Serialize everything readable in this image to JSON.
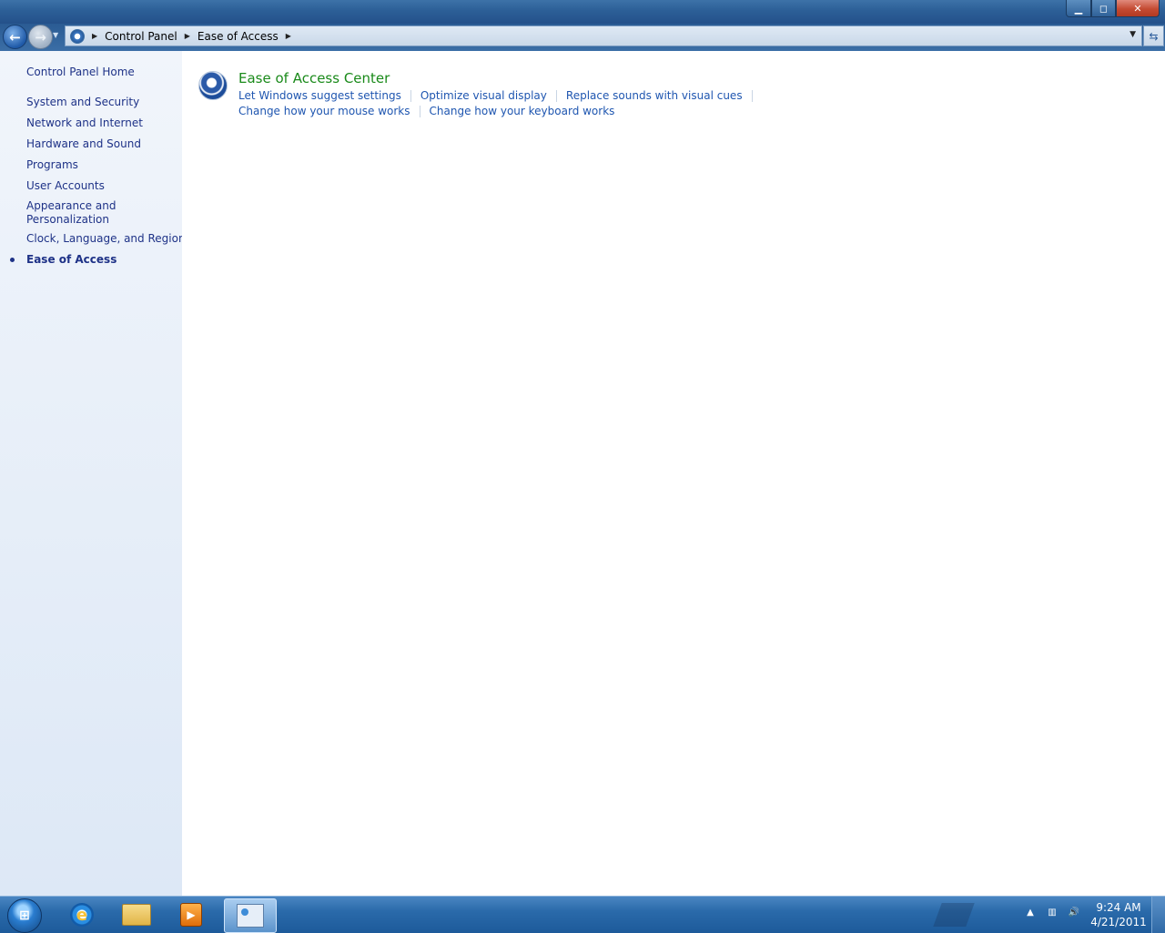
{
  "window": {
    "controls": {
      "minimize": "▁",
      "maximize": "◻",
      "close": "✕"
    }
  },
  "nav": {
    "back_icon": "arrow-left",
    "forward_icon": "arrow-right",
    "breadcrumbs": [
      "Control Panel",
      "Ease of Access"
    ],
    "refresh_icon": "refresh"
  },
  "sidebar": {
    "home": "Control Panel Home",
    "items": [
      "System and Security",
      "Network and Internet",
      "Hardware and Sound",
      "Programs",
      "User Accounts",
      "Appearance and Personalization",
      "Clock, Language, and Region",
      "Ease of Access"
    ],
    "current_item": "Ease of Access"
  },
  "main": {
    "category": {
      "title": "Ease of Access Center",
      "icon": "ease-of-access-icon",
      "title_color": "#1a8a1a",
      "links_row1": [
        "Let Windows suggest settings",
        "Optimize visual display",
        "Replace sounds with visual cues"
      ],
      "links_row2": [
        "Change how your mouse works",
        "Change how your keyboard works"
      ]
    }
  },
  "taskbar": {
    "pinned": [
      "internet-explorer-icon",
      "windows-explorer-icon",
      "media-player-icon",
      "control-panel-icon"
    ],
    "active": "control-panel-icon",
    "clock": {
      "time": "9:24 AM",
      "date": "4/21/2011"
    }
  },
  "colors": {
    "link": "#1f56b0",
    "sidebar_link": "#1e3287",
    "titlebar": "#2c5f97"
  }
}
